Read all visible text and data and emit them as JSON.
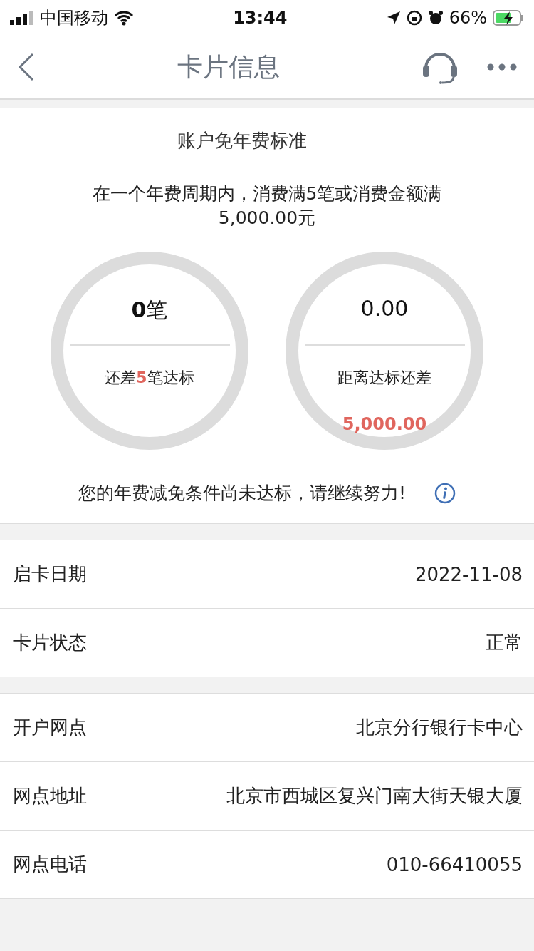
{
  "status_bar": {
    "carrier": "中国移动",
    "time": "13:44",
    "battery": "66%"
  },
  "nav": {
    "title": "卡片信息"
  },
  "fee_card": {
    "title": "账户免年费标准",
    "description": "在一个年费周期内，消费满5笔或消费金额满5,000.00元",
    "rings": [
      {
        "value": "**0**笔",
        "caption": "还差**5**笔达标"
      },
      {
        "value": "0.00",
        "caption": "距离达标还差",
        "remaining": "5,000.00"
      }
    ],
    "notice": "您的年费减免条件尚未达标，请继续努力!"
  },
  "groups": [
    [
      {
        "label": "启卡日期",
        "value": "2022-11-08"
      },
      {
        "label": "卡片状态",
        "value": "正常"
      }
    ],
    [
      {
        "label": "开户网点",
        "value": "北京分行银行卡中心"
      },
      {
        "label": "网点地址",
        "value": "北京市西城区复兴门南大街天银大厦"
      },
      {
        "label": "网点电话",
        "value": "010-66410055"
      }
    ]
  ]
}
